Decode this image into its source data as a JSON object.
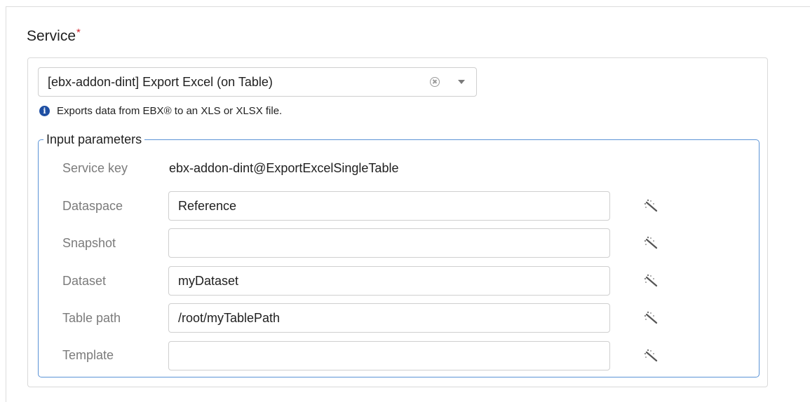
{
  "service": {
    "label": "Service",
    "required_marker": "*",
    "selected_value": "[ebx-addon-dint] Export Excel (on Table)",
    "info_text": "Exports data from EBX® to an XLS or XLSX file."
  },
  "input_parameters": {
    "legend": "Input parameters",
    "service_key_label": "Service key",
    "service_key_value": "ebx-addon-dint@ExportExcelSingleTable",
    "rows": [
      {
        "label": "Dataspace",
        "value": ""
      },
      {
        "label": "Snapshot",
        "value": ""
      },
      {
        "label": "Dataset",
        "value": ""
      },
      {
        "label": "Table path",
        "value": ""
      },
      {
        "label": "Template",
        "value": ""
      }
    ],
    "values": {
      "dataspace": "Reference",
      "snapshot": "",
      "dataset": "myDataset",
      "table_path": "/root/myTablePath",
      "template": ""
    }
  },
  "icons": {
    "clear": "clear-circle-icon",
    "dropdown": "chevron-down-icon",
    "info": "info-icon",
    "wand": "magic-wand-icon"
  },
  "colors": {
    "required": "#d0202a",
    "fieldset_border": "#5b93d6",
    "info_icon": "#1e4fa3"
  }
}
